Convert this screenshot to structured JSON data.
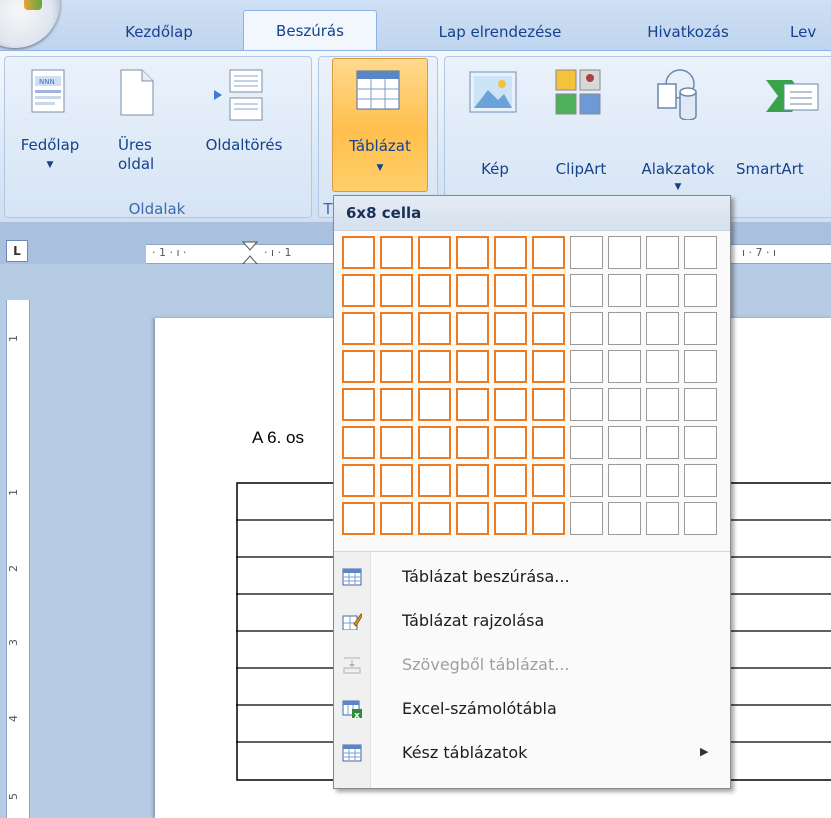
{
  "tabs": [
    {
      "label": "Kezdőlap",
      "active": false
    },
    {
      "label": "Beszúrás",
      "active": true
    },
    {
      "label": "Lap elrendezése",
      "active": false
    },
    {
      "label": "Hivatkozás",
      "active": false
    },
    {
      "label": "Lev",
      "active": false
    }
  ],
  "ribbon": {
    "pages_group": {
      "label": "Oldalak",
      "buttons": [
        {
          "label": "Fedőlap",
          "icon": "cover-page-icon",
          "has_dropdown": true
        },
        {
          "label_line1": "Üres",
          "label_line2": "oldal",
          "icon": "blank-page-icon"
        },
        {
          "label": "Oldaltörés",
          "icon": "page-break-icon"
        }
      ]
    },
    "tables_group": {
      "label": "T",
      "button": {
        "label": "Táblázat",
        "icon": "table-icon",
        "has_dropdown": true
      }
    },
    "illustrations_group": {
      "buttons": [
        {
          "label": "Kép",
          "icon": "picture-icon"
        },
        {
          "label": "ClipArt",
          "icon": "clipart-icon"
        },
        {
          "label": "Alakzatok",
          "icon": "shapes-icon",
          "has_dropdown": true
        },
        {
          "label": "SmartArt",
          "icon": "smartart-icon"
        }
      ]
    }
  },
  "ruler": {
    "corner": "L",
    "left_text": "· 1 · ı ·",
    "left_text2": "· ı · 1",
    "right_text": "ı · 7 · ı",
    "vertical_marks": [
      "1",
      "1",
      "2",
      "3",
      "4",
      "5"
    ]
  },
  "document": {
    "visible_text": "A 6. os"
  },
  "table_menu": {
    "header": "6x8 cella",
    "grid": {
      "columns": 10,
      "rows": 8,
      "selected_columns": 6,
      "selected_rows": 8
    },
    "items": [
      {
        "label": "Táblázat beszúrása...",
        "icon": "insert-table-icon",
        "enabled": true,
        "submenu": false
      },
      {
        "label": "Táblázat rajzolása",
        "icon": "draw-table-icon",
        "enabled": true,
        "submenu": false
      },
      {
        "label": "Szövegből táblázat...",
        "icon": "convert-text-to-table-icon",
        "enabled": false,
        "submenu": false
      },
      {
        "label": "Excel-számolótábla",
        "icon": "excel-spreadsheet-icon",
        "enabled": true,
        "submenu": false
      },
      {
        "label": "Kész táblázatok",
        "icon": "quick-tables-icon",
        "enabled": true,
        "submenu": true
      }
    ]
  },
  "colors": {
    "selection_orange": "#f07a1e",
    "ribbon_text": "#15428b",
    "tab_background": "#bfd4ee"
  }
}
